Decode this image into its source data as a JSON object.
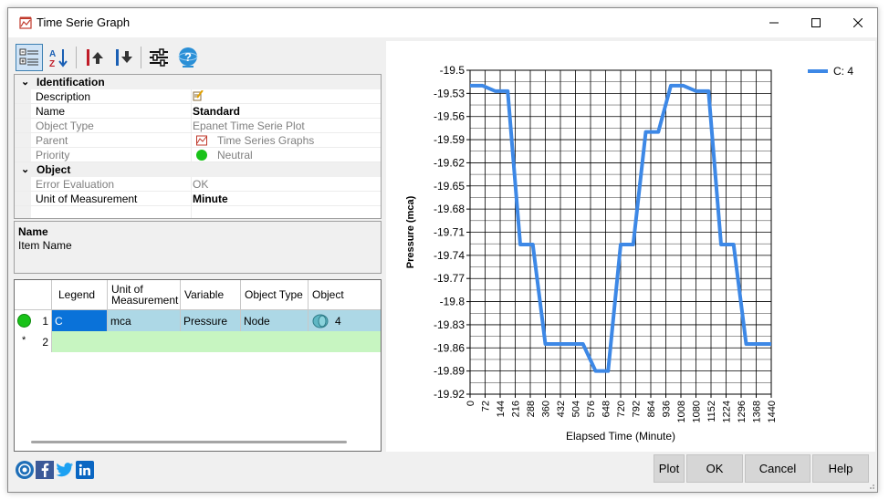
{
  "window": {
    "title": "Time Serie Graph"
  },
  "toolbar": {
    "items": [
      "categorized-view",
      "alphabetical-sort",
      "move-up",
      "move-down",
      "settings",
      "help"
    ]
  },
  "properties": {
    "categories": [
      {
        "label": "Identification",
        "items": [
          {
            "label": "Description",
            "value": ""
          },
          {
            "label": "Name",
            "value": "Standard"
          },
          {
            "label": "Object Type",
            "value": "Epanet Time Serie Plot"
          },
          {
            "label": "Parent",
            "value": "Time Series Graphs"
          },
          {
            "label": "Priority",
            "value": "Neutral"
          }
        ]
      },
      {
        "label": "Object",
        "items": [
          {
            "label": "Error Evaluation",
            "value": "OK"
          },
          {
            "label": "Unit of Measurement",
            "value": "Minute"
          }
        ]
      }
    ]
  },
  "description_panel": {
    "name": "Name",
    "text": "Item Name"
  },
  "grid": {
    "headers": [
      "Legend",
      "Unit of Measurement",
      "Variable",
      "Object Type",
      "Object"
    ],
    "rows": [
      {
        "num": "1",
        "legend": "C",
        "unit": "mca",
        "variable": "Pressure",
        "object_type": "Node",
        "object": "4"
      },
      {
        "num": "2",
        "legend": "",
        "unit": "",
        "variable": "",
        "object_type": "",
        "object": ""
      }
    ]
  },
  "buttons": {
    "plot": "Plot",
    "ok": "OK",
    "cancel": "Cancel",
    "help": "Help"
  },
  "colors": {
    "series": "#3d88e6",
    "selected_row": "#add8e6",
    "new_row": "#c7f5c1",
    "legend_cell": "#0a72d9",
    "status_green": "#19c219"
  },
  "chart_data": {
    "type": "line",
    "xlabel": "Elapsed Time (Minute)",
    "ylabel": "Pressure (mca)",
    "ylim": [
      -19.92,
      -19.5
    ],
    "yticks": [
      "-19.5",
      "-19.53",
      "-19.56",
      "-19.59",
      "-19.62",
      "-19.65",
      "-19.68",
      "-19.71",
      "-19.74",
      "-19.77",
      "-19.8",
      "-19.83",
      "-19.86",
      "-19.89",
      "-19.92"
    ],
    "xticks": [
      "0",
      "72",
      "144",
      "216",
      "288",
      "360",
      "432",
      "504",
      "576",
      "648",
      "720",
      "792",
      "864",
      "936",
      "1008",
      "1080",
      "1152",
      "1224",
      "1296",
      "1368",
      "1440"
    ],
    "xlim": [
      0,
      1440
    ],
    "grid": true,
    "legend_position": "top-right",
    "series": [
      {
        "name": "C: 4",
        "x": [
          0,
          60,
          120,
          180,
          240,
          300,
          360,
          420,
          480,
          540,
          600,
          660,
          720,
          780,
          840,
          900,
          960,
          1020,
          1080,
          1140,
          1200,
          1260,
          1320,
          1380,
          1440
        ],
        "y": [
          -19.52,
          -19.52,
          -19.527,
          -19.527,
          -19.726,
          -19.726,
          -19.855,
          -19.855,
          -19.855,
          -19.855,
          -19.89,
          -19.89,
          -19.726,
          -19.726,
          -19.58,
          -19.58,
          -19.52,
          -19.52,
          -19.527,
          -19.527,
          -19.726,
          -19.726,
          -19.855,
          -19.855,
          -19.855
        ]
      }
    ]
  }
}
